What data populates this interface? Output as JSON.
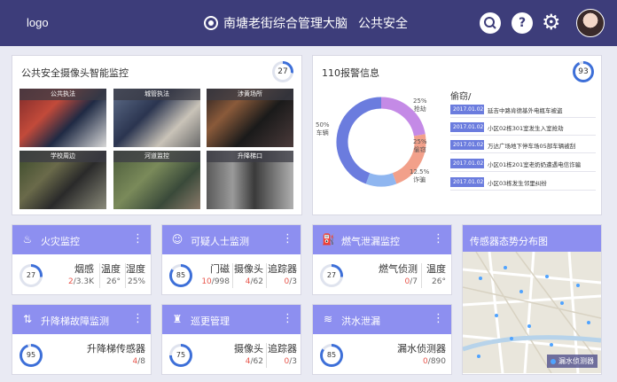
{
  "header": {
    "logo": "logo",
    "title": "南塘老街综合管理大脑",
    "subtitle": "公共安全",
    "help": "?"
  },
  "camera_panel": {
    "title": "公共安全摄像头智能监控",
    "badge": "27",
    "badge_pct": 0.27,
    "cams": [
      {
        "label": "公共执法"
      },
      {
        "label": "城管执法"
      },
      {
        "label": "涉黄场所"
      },
      {
        "label": "学校周边"
      },
      {
        "label": "河道监控"
      },
      {
        "label": "升降梯口"
      }
    ]
  },
  "alarm_panel": {
    "title": "110报警信息",
    "badge": "93",
    "badge_pct": 0.93,
    "chart_data": {
      "type": "pie",
      "categories": [
        "车辆",
        "抢劫",
        "偷窃",
        "诈骗"
      ],
      "values": [
        50,
        25,
        25,
        12.5
      ],
      "labels": [
        "50%\n车辆",
        "25%\n抢劫",
        "25%\n偷窃",
        "12.5%\n诈骗"
      ],
      "colors": [
        "#6b7cde",
        "#c48ae6",
        "#f2a08a",
        "#8fb6f0"
      ]
    },
    "feed_title": "偷窃/",
    "feed": [
      {
        "date": "2017.01.02",
        "text": "延吉中路肯德基外电瓶车被盗"
      },
      {
        "date": "2017.01.02",
        "text": "小区02栋301室发生入室抢劫"
      },
      {
        "date": "2017.01.02",
        "text": "万达广场地下停车场05部车辆被刮"
      },
      {
        "date": "2017.01.02",
        "text": "小区01栋201室老奶奶遭遇电信诈骗"
      },
      {
        "date": "2017.01.02",
        "text": "小区03栋发生邻里纠纷"
      }
    ]
  },
  "cards": [
    {
      "title": "火灾监控",
      "icon": "fire-icon",
      "gauge": "27",
      "pct": 0.27,
      "stats": [
        {
          "label": "烟感",
          "red": "2",
          "rest": "/3.3K"
        },
        {
          "label": "温度",
          "red": "",
          "rest": "26°"
        },
        {
          "label": "湿度",
          "red": "",
          "rest": "25%"
        }
      ]
    },
    {
      "title": "可疑人士监测",
      "icon": "person-icon",
      "gauge": "85",
      "pct": 0.85,
      "stats": [
        {
          "label": "门磁",
          "red": "10",
          "rest": "/998"
        },
        {
          "label": "摄像头",
          "red": "4",
          "rest": "/62"
        },
        {
          "label": "追踪器",
          "red": "0",
          "rest": "/3"
        }
      ]
    },
    {
      "title": "燃气泄漏监控",
      "icon": "gas-icon",
      "gauge": "27",
      "pct": 0.27,
      "stats": [
        {
          "label": "燃气侦测",
          "red": "0",
          "rest": "/7"
        },
        {
          "label": "温度",
          "red": "",
          "rest": "26°"
        }
      ]
    },
    {
      "title": "升降梯故障监测",
      "icon": "elevator-icon",
      "gauge": "95",
      "pct": 0.95,
      "stats": [
        {
          "label": "升降梯传感器",
          "red": "4",
          "rest": "/8"
        }
      ]
    },
    {
      "title": "巡更管理",
      "icon": "patrol-icon",
      "gauge": "75",
      "pct": 0.75,
      "stats": [
        {
          "label": "摄像头",
          "red": "4",
          "rest": "/62"
        },
        {
          "label": "追踪器",
          "red": "0",
          "rest": "/3"
        }
      ]
    },
    {
      "title": "洪水泄漏",
      "icon": "flood-icon",
      "gauge": "85",
      "pct": 0.85,
      "stats": [
        {
          "label": "漏水侦测器",
          "red": "0",
          "rest": "/890"
        }
      ]
    }
  ],
  "map_panel": {
    "title": "传感器态势分布图",
    "legend": "漏水侦测器"
  },
  "colors": {
    "header": "#3d3d7a",
    "card_head": "#8d8ff0",
    "accent": "#3d6fd8",
    "alert": "#e8564c"
  }
}
